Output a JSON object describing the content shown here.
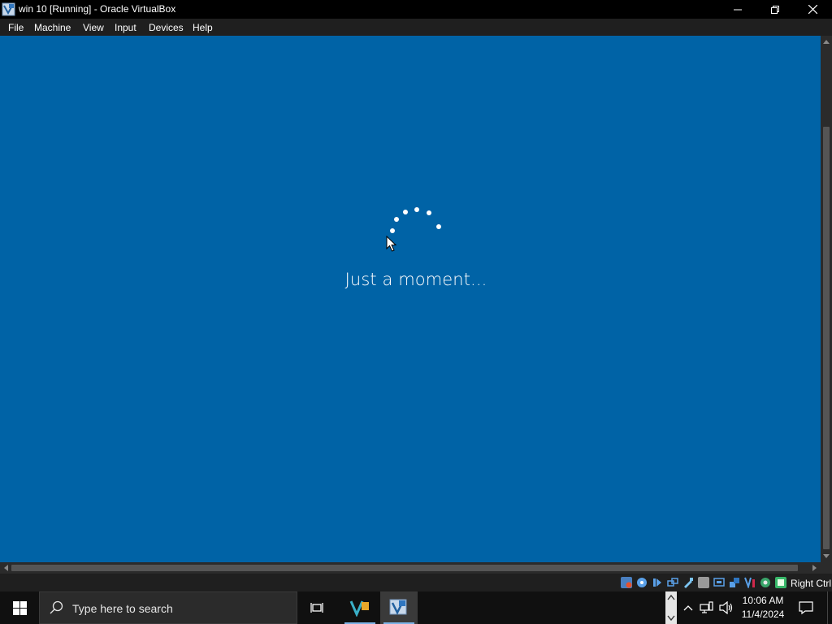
{
  "window": {
    "title": "win 10 [Running] - Oracle VirtualBox",
    "controls": {
      "minimize": "minimize-icon",
      "maximize": "restore-icon",
      "close": "close-icon"
    }
  },
  "menu": {
    "items": [
      {
        "label": "File"
      },
      {
        "label": "Machine"
      },
      {
        "label": "View"
      },
      {
        "label": "Input"
      },
      {
        "label": "Devices"
      },
      {
        "label": "Help"
      }
    ]
  },
  "vm": {
    "background_color": "#0063a6",
    "status_text": "Just a moment...",
    "spinner_icon": "loading-dots-icon"
  },
  "vbox_status": {
    "icons": [
      "hard-disk-icon",
      "optical-drive-icon",
      "audio-icon",
      "network-icon",
      "usb-icon",
      "shared-folders-icon",
      "display-icon",
      "video-capture-icon",
      "mouse-integration-icon",
      "recording-icon",
      "cpu-icon",
      "keyboard-icon"
    ],
    "host_key": "Right Ctrl"
  },
  "taskbar": {
    "search_placeholder": "Type here to search",
    "clock_time": "10:06 AM",
    "clock_date": "11/4/2024",
    "accent": "#7cb2e6"
  }
}
